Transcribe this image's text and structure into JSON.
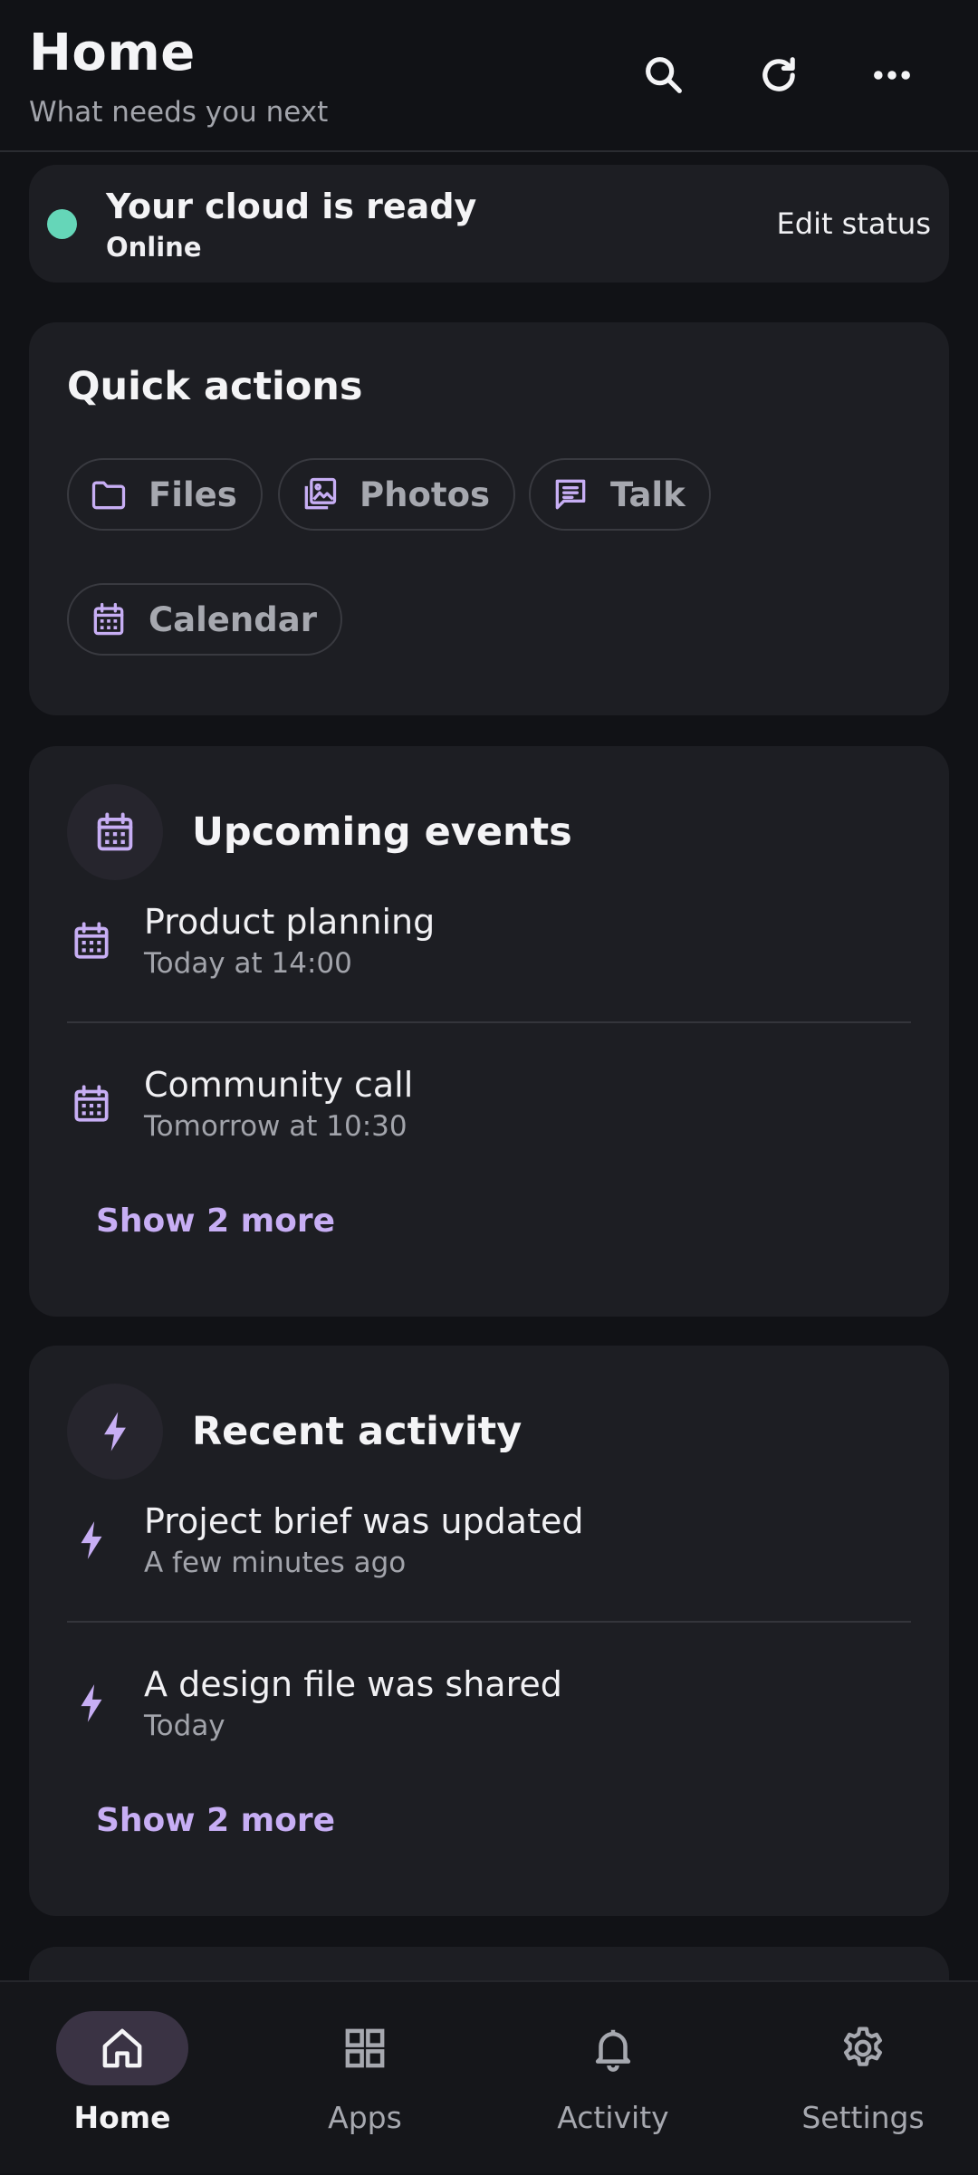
{
  "header": {
    "title": "Home",
    "subtitle": "What needs you next"
  },
  "header_actions": {
    "search": "search-icon",
    "refresh": "refresh-icon",
    "more": "more-icon"
  },
  "status": {
    "title": "Your cloud is ready",
    "subtitle": "Online",
    "action_label": "Edit status",
    "dot_color": "#65D6B8"
  },
  "quick_actions": {
    "heading": "Quick actions",
    "items": [
      {
        "label": "Files",
        "icon": "folder-icon"
      },
      {
        "label": "Photos",
        "icon": "photos-icon"
      },
      {
        "label": "Talk",
        "icon": "chat-icon"
      },
      {
        "label": "Calendar",
        "icon": "calendar-icon"
      }
    ]
  },
  "events": {
    "heading": "Upcoming events",
    "items": [
      {
        "title": "Product planning",
        "subtitle": "Today at 14:00"
      },
      {
        "title": "Community call",
        "subtitle": "Tomorrow at 10:30"
      }
    ],
    "show_more": "Show 2 more"
  },
  "activity": {
    "heading": "Recent activity",
    "items": [
      {
        "title": "Project brief was updated",
        "subtitle": "A few minutes ago"
      },
      {
        "title": "A design file was shared",
        "subtitle": "Today"
      }
    ],
    "show_more": "Show 2 more"
  },
  "nav": {
    "items": [
      {
        "label": "Home",
        "icon": "home-icon",
        "active": true
      },
      {
        "label": "Apps",
        "icon": "apps-icon",
        "active": false
      },
      {
        "label": "Activity",
        "icon": "bell-icon",
        "active": false
      },
      {
        "label": "Settings",
        "icon": "gear-icon",
        "active": false
      }
    ]
  },
  "colors": {
    "accent": "#C7AEF4",
    "background": "#111216",
    "card": "#1D1E23",
    "online": "#65D6B8"
  }
}
